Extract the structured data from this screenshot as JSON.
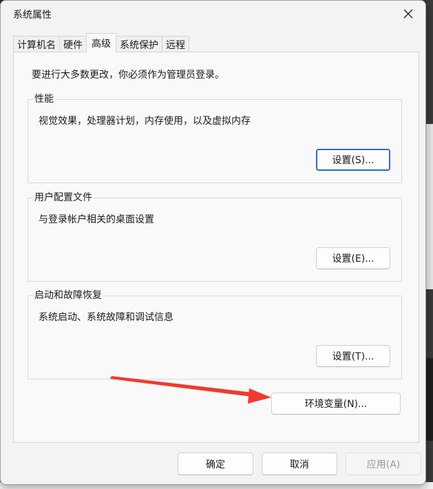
{
  "window": {
    "title": "系统属性",
    "close_icon": "close-icon"
  },
  "tabs": [
    {
      "label": "计算机名"
    },
    {
      "label": "硬件"
    },
    {
      "label": "高级",
      "active": true
    },
    {
      "label": "系统保护"
    },
    {
      "label": "远程"
    }
  ],
  "notice": "要进行大多数更改，你必须作为管理员登录。",
  "groups": {
    "performance": {
      "title": "性能",
      "description": "视觉效果，处理器计划，内存使用，以及虚拟内存",
      "button": "设置(S)..."
    },
    "user_profiles": {
      "title": "用户配置文件",
      "description": "与登录帐户相关的桌面设置",
      "button": "设置(E)..."
    },
    "startup_recovery": {
      "title": "启动和故障恢复",
      "description": "系统启动、系统故障和调试信息",
      "button": "设置(T)..."
    }
  },
  "env_button": "环境变量(N)...",
  "footer": {
    "ok": "确定",
    "cancel": "取消",
    "apply": "应用(A)"
  },
  "colors": {
    "annotation_arrow": "#f03a2e",
    "focus_border": "#2f6bbd"
  }
}
